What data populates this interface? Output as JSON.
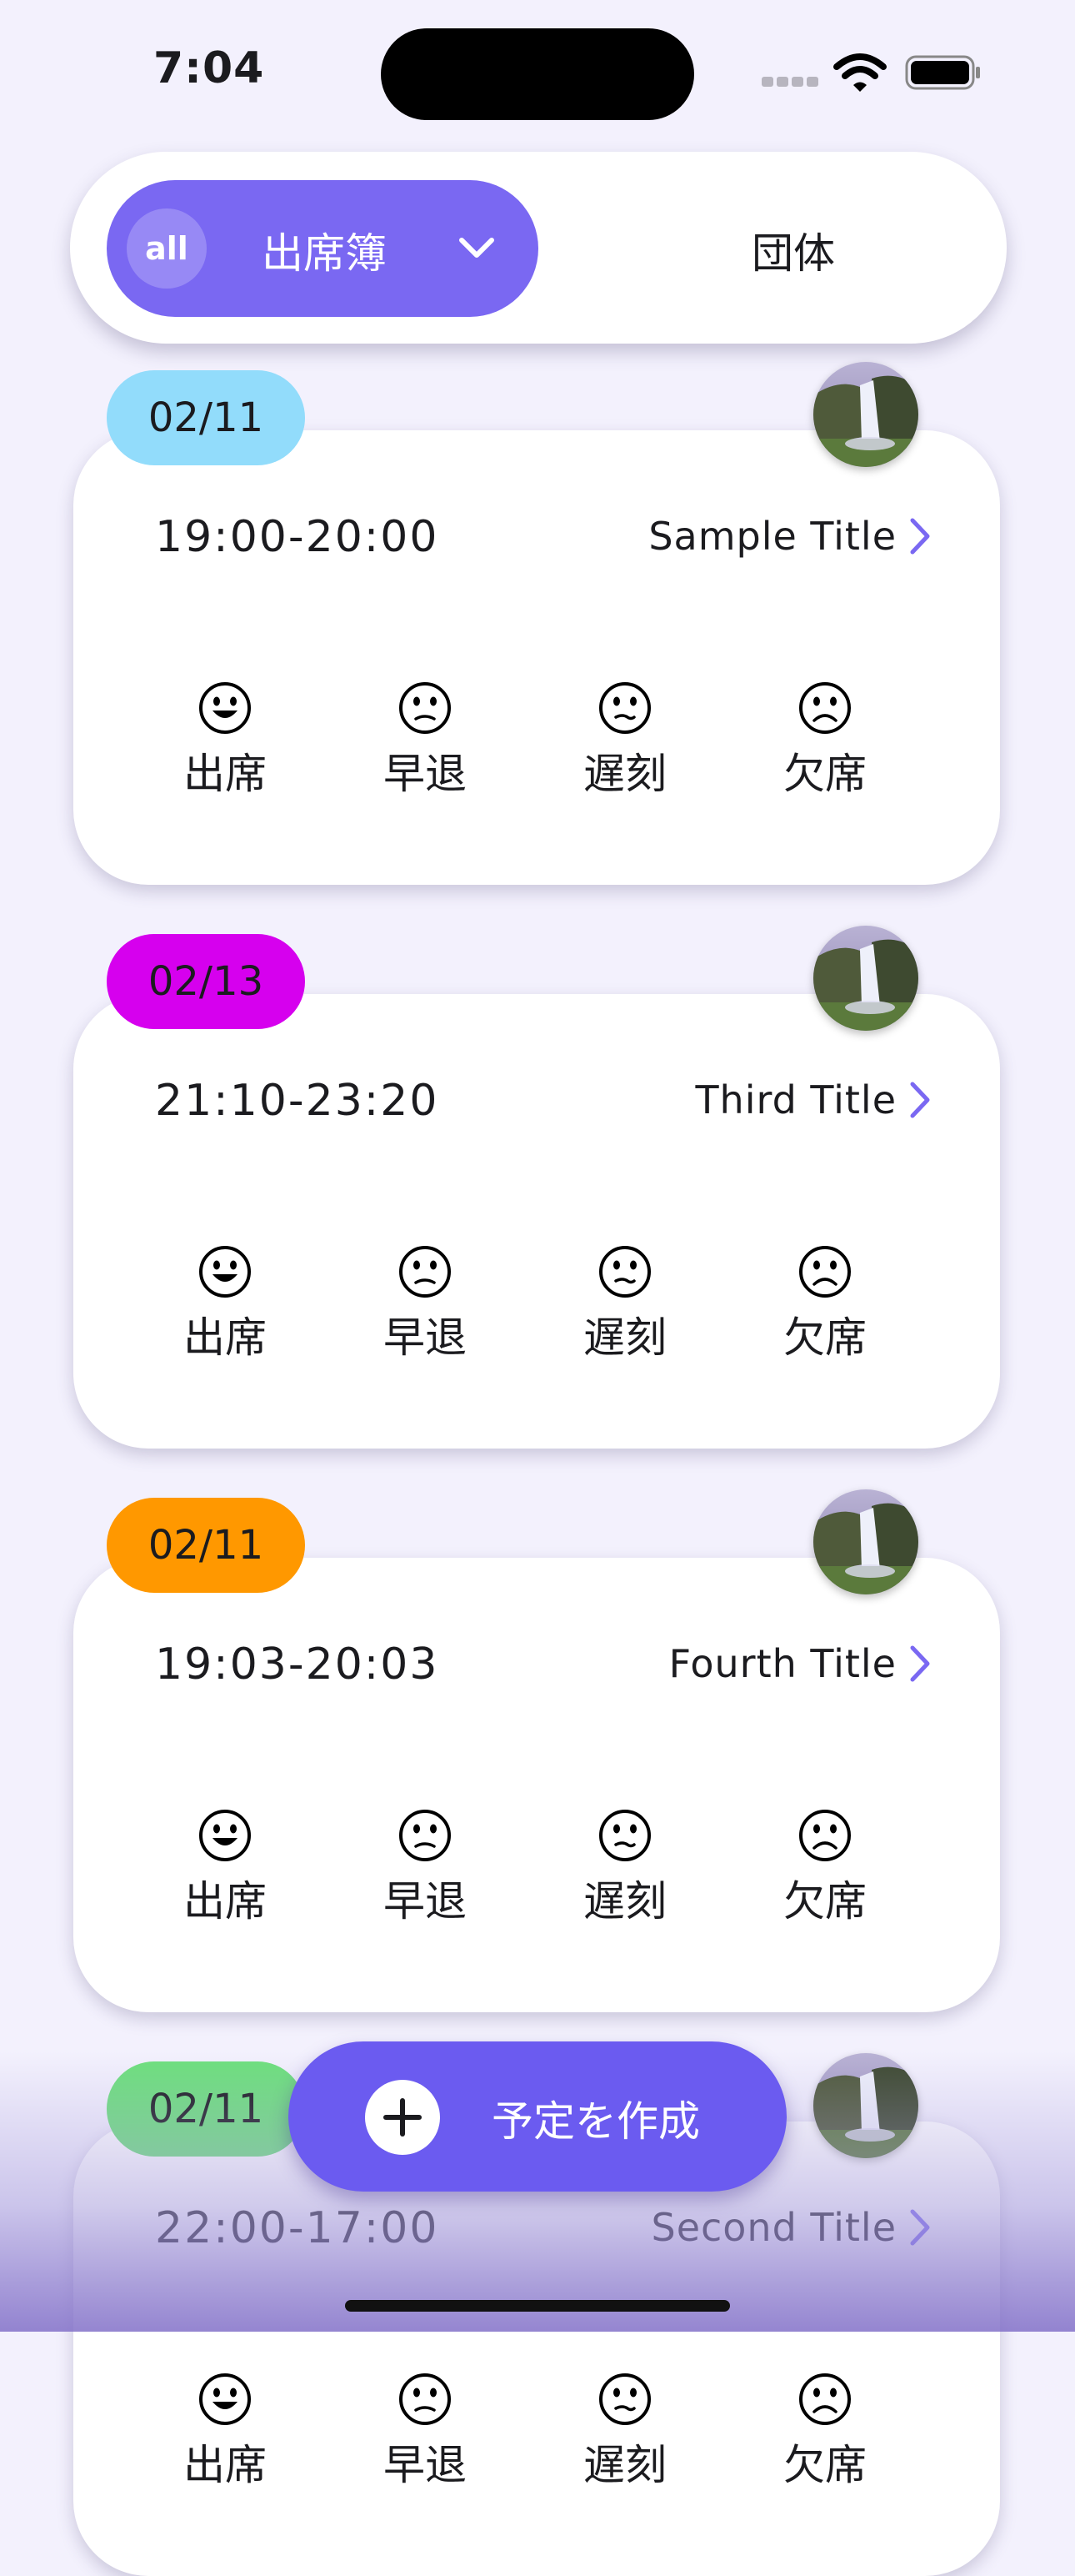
{
  "status_bar": {
    "time": "7:04"
  },
  "header": {
    "all_chip": "all",
    "book_label": "出席簿",
    "group_tab": "団体"
  },
  "events": [
    {
      "date": "02/11",
      "date_color": "#92dcfb",
      "time": "19:00-20:00",
      "title": "Sample Title"
    },
    {
      "date": "02/13",
      "date_color": "#d600ee",
      "time": "21:10-23:20",
      "title": "Third Title"
    },
    {
      "date": "02/11",
      "date_color": "#ff9800",
      "time": "19:03-20:03",
      "title": "Fourth Title"
    },
    {
      "date": "02/11",
      "date_color": "#6de07c",
      "time": "22:00-17:00",
      "title": "Second Title"
    }
  ],
  "attendance_options": [
    "出席",
    "早退",
    "遅刻",
    "欠席"
  ],
  "fab": {
    "label": "予定を作成"
  },
  "colors": {
    "accent": "#7a68f2",
    "fab": "#6b5bf0",
    "background": "#f3f1fd"
  }
}
